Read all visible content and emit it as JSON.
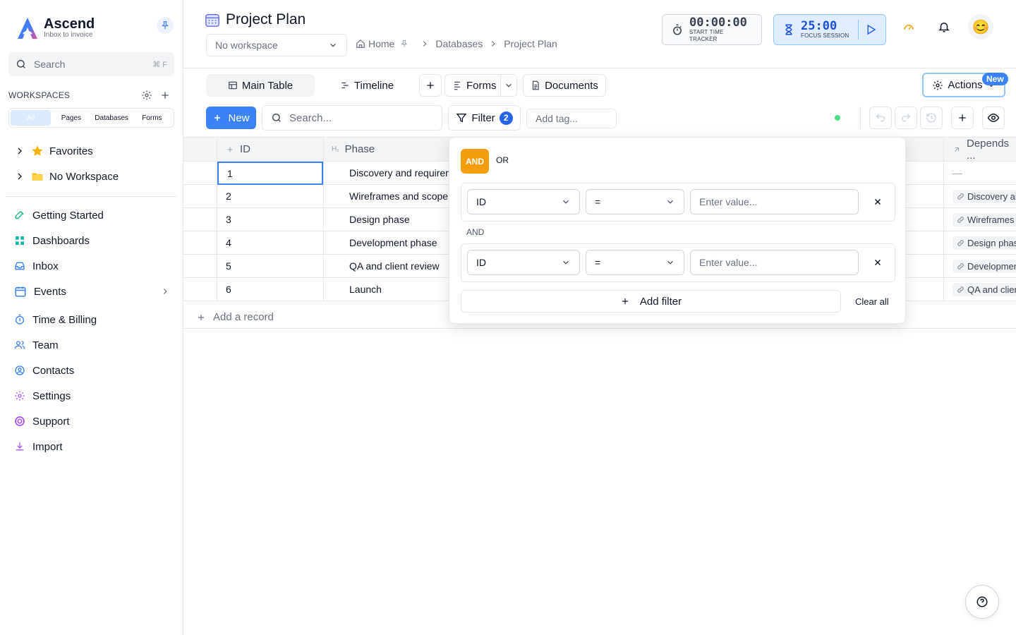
{
  "brand": {
    "name": "Ascend",
    "tagline": "Inbox to invoice"
  },
  "sidebar": {
    "search_placeholder": "Search",
    "search_shortcut": "⌘ F",
    "workspaces_label": "WORKSPACES",
    "filter_tabs": [
      "All",
      "Pages",
      "Databases",
      "Forms"
    ],
    "tree": [
      {
        "label": "Favorites",
        "icon": "star-icon"
      },
      {
        "label": "No Workspace",
        "icon": "folder-icon"
      }
    ],
    "nav": [
      {
        "label": "Getting Started",
        "icon": "rocket-icon"
      },
      {
        "label": "Dashboards",
        "icon": "dashboard-icon"
      },
      {
        "label": "Inbox",
        "icon": "inbox-icon"
      },
      {
        "label": "Events",
        "icon": "calendar-icon"
      },
      {
        "label": "Time & Billing",
        "icon": "timer-icon"
      },
      {
        "label": "Team",
        "icon": "team-icon"
      },
      {
        "label": "Contacts",
        "icon": "contact-icon"
      },
      {
        "label": "Settings",
        "icon": "gear-icon"
      },
      {
        "label": "Support",
        "icon": "support-icon"
      },
      {
        "label": "Import",
        "icon": "import-icon"
      }
    ]
  },
  "header": {
    "title": "Project Plan",
    "workspace_select": "No workspace",
    "breadcrumb": [
      "Home",
      "Databases",
      "Project Plan"
    ],
    "time_tracker": {
      "time": "00:00:00",
      "label": "START TIME TRACKER"
    },
    "focus": {
      "time": "25:00",
      "label": "FOCUS SESSION"
    },
    "avatar": "😊"
  },
  "views": {
    "main_table": "Main Table",
    "timeline": "Timeline",
    "forms": "Forms",
    "documents": "Documents",
    "actions": "Actions",
    "actions_badge": "New"
  },
  "toolbar": {
    "new_label": "New",
    "search_placeholder": "Search...",
    "filter_label": "Filter",
    "filter_count": "2",
    "tag_placeholder": "Add tag..."
  },
  "table": {
    "columns": [
      "ID",
      "Phase",
      "Depends ..."
    ],
    "rows": [
      {
        "id": "1",
        "phase": "Discovery and requirem",
        "depends": "—"
      },
      {
        "id": "2",
        "phase": "Wireframes and scope s",
        "depends": "Discovery ar"
      },
      {
        "id": "3",
        "phase": "Design phase",
        "depends": "Wireframes a"
      },
      {
        "id": "4",
        "phase": "Development phase",
        "depends": "Design phas"
      },
      {
        "id": "5",
        "phase": "QA and client review",
        "depends": "Developmen"
      },
      {
        "id": "6",
        "phase": "Launch",
        "depends": "QA and clien"
      }
    ],
    "add_record": "Add a record"
  },
  "filter_popover": {
    "and_label": "AND",
    "or_label": "OR",
    "conjunction": "AND",
    "rows": [
      {
        "field": "ID",
        "operator": "=",
        "value_placeholder": "Enter value..."
      },
      {
        "field": "ID",
        "operator": "=",
        "value_placeholder": "Enter value..."
      }
    ],
    "add_filter": "Add filter",
    "clear_all": "Clear all"
  },
  "colors": {
    "accent": "#3b82f6",
    "and_toggle": "#f59e0b",
    "status_online": "#4ade80"
  }
}
